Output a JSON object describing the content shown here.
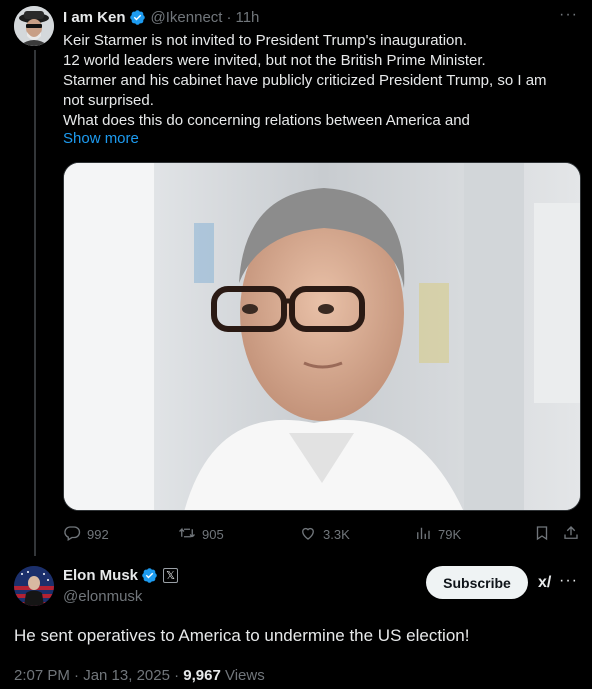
{
  "parent_tweet": {
    "author_name": "I am Ken",
    "handle": "@Ikennect",
    "separator": "·",
    "time": "11h",
    "more": "···",
    "lines": [
      "Keir Starmer is not invited to President Trump's inauguration.",
      "12 world leaders were invited, but not the British Prime Minister.",
      "Starmer and his cabinet have publicly criticized President Trump, so I am",
      "not surprised.",
      "What does this do concerning relations between America and"
    ],
    "show_more": "Show more",
    "actions": {
      "replies": "992",
      "reposts": "905",
      "likes": "3.3K",
      "views": "79K"
    }
  },
  "main_tweet": {
    "author_name": "Elon Musk",
    "handle": "@elonmusk",
    "affiliate_badge": "𝕏",
    "subscribe_label": "Subscribe",
    "grok_label": "x/",
    "more": "···",
    "text": "He sent operatives to America to undermine the US election!",
    "timestamp": "2:07 PM · Jan 13, 2025 · ",
    "views_count": "9,967",
    "views_label": " Views"
  },
  "colors": {
    "background": "#000000",
    "text": "#e7e9ea",
    "secondary": "#71767b",
    "accent": "#1d9bf0",
    "verified": "#1d9bf0"
  },
  "icons": [
    "verified-badge-icon",
    "reply-icon",
    "repost-icon",
    "like-icon",
    "views-icon",
    "bookmark-icon",
    "share-icon",
    "more-icon",
    "grok-icon"
  ]
}
